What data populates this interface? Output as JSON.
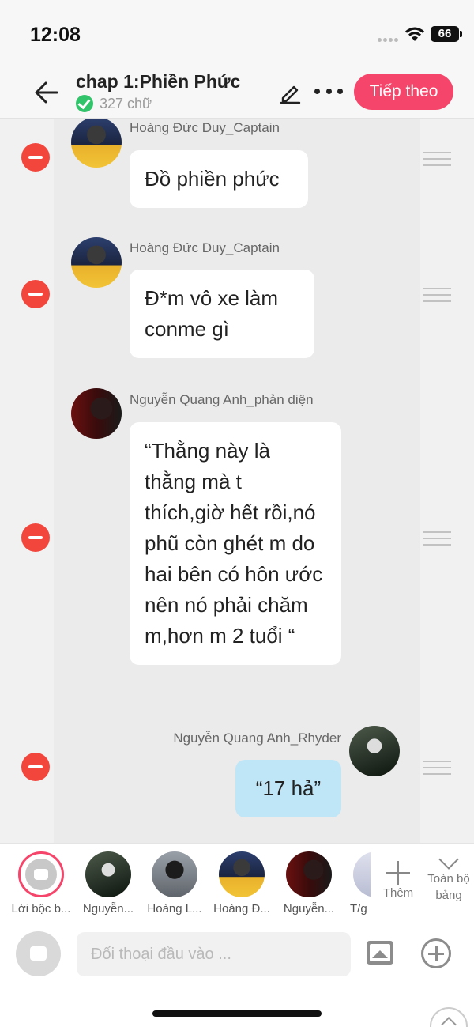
{
  "status_bar": {
    "time": "12:08",
    "battery": "66"
  },
  "header": {
    "title": "chap 1:Phiền Phức",
    "word_count": "327 chữ",
    "next_label": "Tiếp theo",
    "accent_color": "#f6456a"
  },
  "messages": [
    {
      "sender": "Hoàng Đức Duy_Captain",
      "text": "Đồ phiền phức",
      "side": "left"
    },
    {
      "sender": "Hoàng Đức Duy_Captain",
      "text": "Đ*m vô xe làm conme gì",
      "side": "left"
    },
    {
      "sender": "Nguyễn Quang Anh_phản diện",
      "text": "“Thằng này là thằng mà t thích,giờ hết rồi,nó phũ còn ghét m do hai bên có hôn ước nên nó phải chăm m,hơn m 2 tuổi “",
      "side": "left"
    },
    {
      "sender": "Nguyễn Quang Anh_Rhyder",
      "text": "“17 hả”",
      "side": "right"
    }
  ],
  "characters": [
    {
      "label": "Lời bộc b...",
      "type": "narration"
    },
    {
      "label": "Nguyễn...",
      "type": "rhyder"
    },
    {
      "label": "Hoàng L...",
      "type": "hoangL"
    },
    {
      "label": "Hoàng Đ...",
      "type": "hoang"
    },
    {
      "label": "Nguyễn...",
      "type": "quang-pd"
    },
    {
      "label": "T/g",
      "type": "tg"
    }
  ],
  "add_label": "Thêm",
  "fullboard_label": "Toàn bộ bảng",
  "input": {
    "placeholder": "Đối thoại đầu vào ..."
  }
}
